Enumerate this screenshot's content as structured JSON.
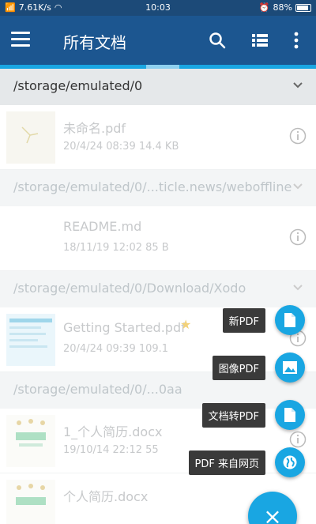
{
  "status": {
    "speed": "7.61K/s",
    "time": "10:03",
    "battery": "88%"
  },
  "appbar": {
    "title": "所有文档"
  },
  "groups": [
    {
      "path": "/storage/emulated/0",
      "items": [
        {
          "name": "未命名.pdf",
          "meta": "20/4/24 08:39   14.4 KB"
        }
      ]
    },
    {
      "path": "/storage/emulated/0/...ticle.news/weboffline",
      "items": [
        {
          "name": "README.md",
          "meta": "18/11/19 12:02   85 B"
        }
      ]
    },
    {
      "path": "/storage/emulated/0/Download/Xodo",
      "items": [
        {
          "name": "Getting Started.pdf",
          "meta": "20/4/24 09:39   109.1"
        }
      ]
    },
    {
      "path": "/storage/emulated/0/...0aa",
      "items": [
        {
          "name": "1_个人简历.docx",
          "meta": "19/10/14 22:12   55"
        },
        {
          "name": "个人简历.docx",
          "meta": ""
        }
      ]
    }
  ],
  "fab_menu": {
    "new_pdf": "新PDF",
    "image_pdf": "图像PDF",
    "convert_pdf": "文档转PDF",
    "web_pdf": "PDF 来自网页",
    "main": "×"
  },
  "colors": {
    "primary": "#1c5690",
    "accent": "#19a6e2"
  }
}
